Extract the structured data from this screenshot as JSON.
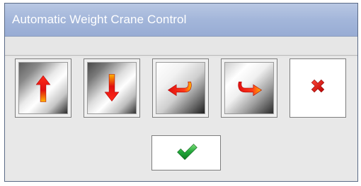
{
  "window": {
    "title": "Automatic Weight Crane Control"
  },
  "buttons": [
    {
      "name": "move-up-button",
      "icon": "arrow-up-icon"
    },
    {
      "name": "move-down-button",
      "icon": "arrow-down-icon"
    },
    {
      "name": "move-left-button",
      "icon": "curved-arrow-left-icon"
    },
    {
      "name": "move-right-button",
      "icon": "curved-arrow-right-icon"
    },
    {
      "name": "cancel-button",
      "icon": "close-x-icon"
    }
  ],
  "confirm": {
    "icon": "checkmark-icon"
  },
  "colors": {
    "titlebar": "#a3b6da",
    "arrow_red": "#e01010",
    "check_green": "#22a83a",
    "background": "#e8e8e8"
  }
}
